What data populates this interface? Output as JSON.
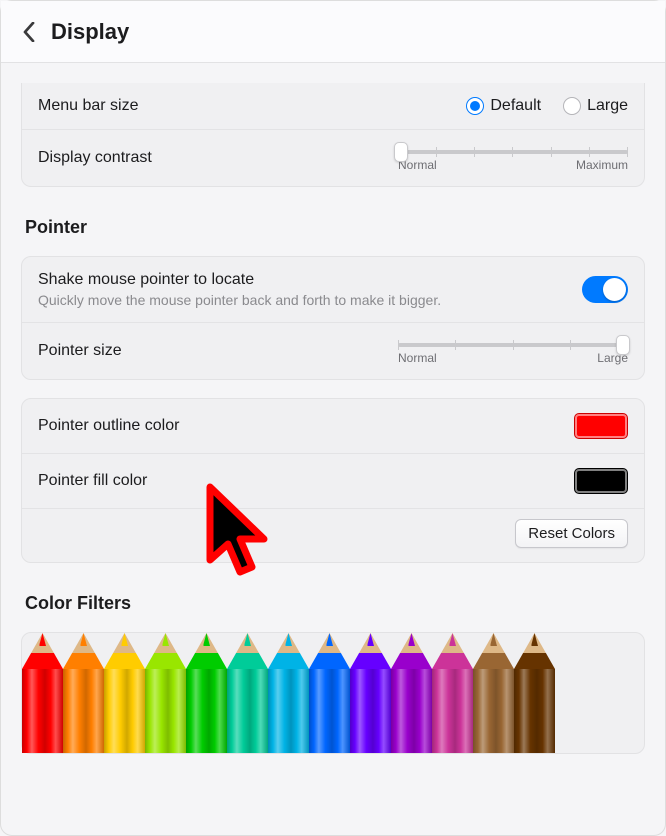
{
  "header": {
    "title": "Display"
  },
  "display": {
    "menu_bar_size_label": "Menu bar size",
    "menu_bar_options": {
      "default": "Default",
      "large": "Large"
    },
    "contrast_label": "Display contrast",
    "contrast_min": "Normal",
    "contrast_max": "Maximum"
  },
  "pointer": {
    "section_title": "Pointer",
    "shake_label": "Shake mouse pointer to locate",
    "shake_help": "Quickly move the mouse pointer back and forth to make it bigger.",
    "size_label": "Pointer size",
    "size_min": "Normal",
    "size_max": "Large",
    "outline_label": "Pointer outline color",
    "outline_color": "#ff0000",
    "fill_label": "Pointer fill color",
    "fill_color": "#000000",
    "reset_label": "Reset Colors"
  },
  "color_filters": {
    "section_title": "Color Filters",
    "pencils": [
      "#ff0000",
      "#ff7f00",
      "#ffcc00",
      "#99e600",
      "#00cc00",
      "#00cc99",
      "#00b3e6",
      "#0066ff",
      "#6600ff",
      "#9900cc",
      "#cc3399",
      "#996633",
      "#663300"
    ]
  }
}
